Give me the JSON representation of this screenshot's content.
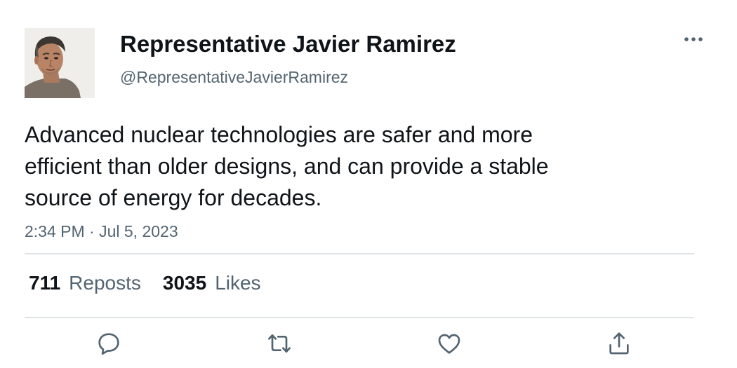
{
  "tweet": {
    "author": {
      "display_name": "Representative Javier Ramirez",
      "handle": "@RepresentativeJavierRamirez",
      "avatar_icon": "profile-photo"
    },
    "text": "Advanced nuclear technologies are safer and more\nefficient than older designs, and can provide a stable\nsource of energy for decades.",
    "timestamp": "2:34 PM · Jul 5, 2023",
    "stats": {
      "reposts_count": "711",
      "reposts_label": "Reposts",
      "likes_count": "3035",
      "likes_label": "Likes"
    },
    "actions": [
      {
        "icon": "reply-icon"
      },
      {
        "icon": "repost-icon"
      },
      {
        "icon": "like-icon"
      },
      {
        "icon": "share-icon"
      }
    ],
    "more_icon": "more-icon"
  },
  "colors": {
    "text_primary": "#0f1419",
    "text_secondary": "#536471",
    "divider": "#dfe3e6"
  }
}
